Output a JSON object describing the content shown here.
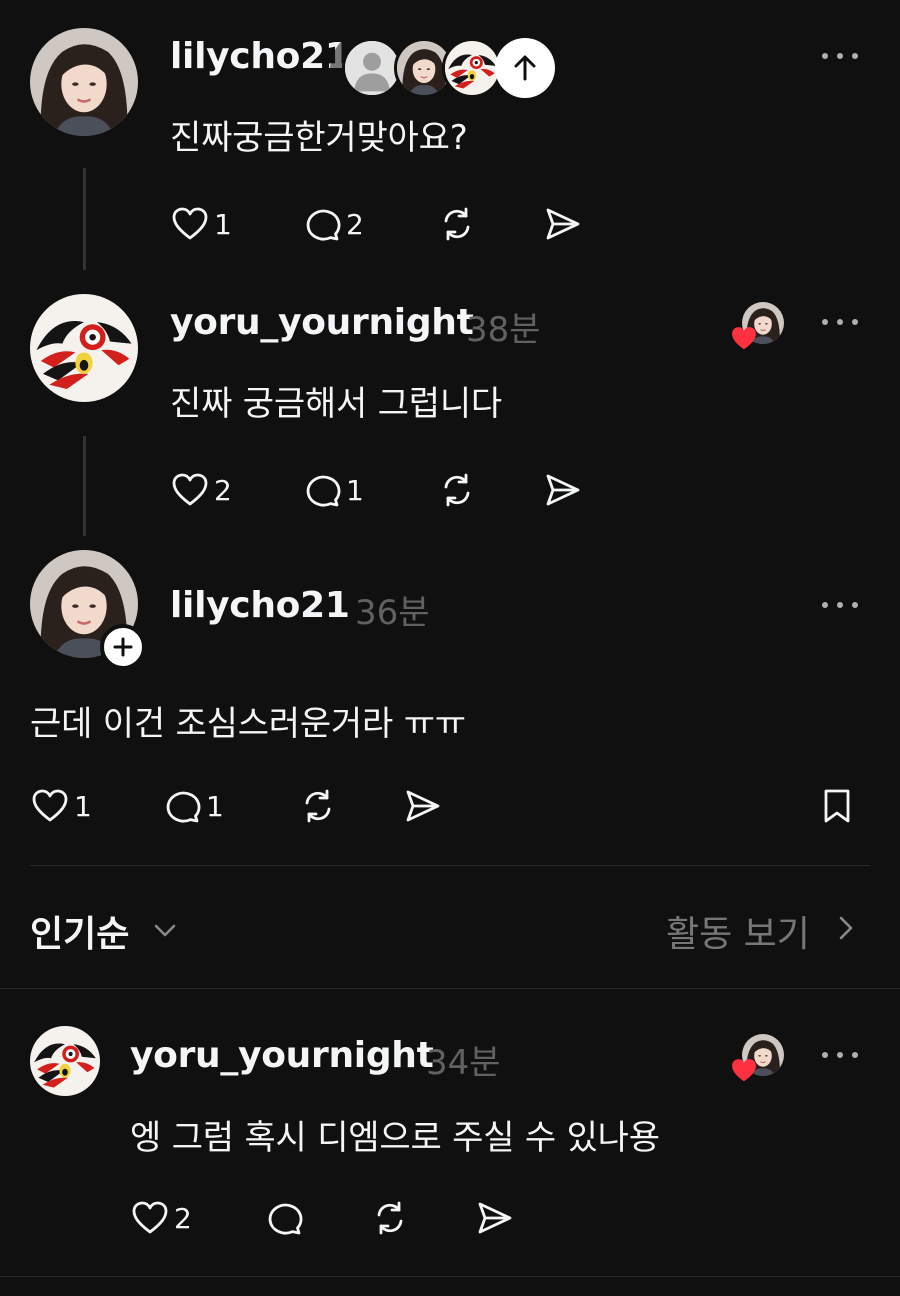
{
  "floating_bar": {
    "icons": [
      "default-avatar-icon",
      "woman-avatar-icon",
      "bird-avatar-icon",
      "arrow-up-icon"
    ]
  },
  "comments": [
    {
      "username": "lilycho21",
      "time": "",
      "text": "진짜궁금한거맞아요?",
      "likes": "1",
      "replies": "2"
    },
    {
      "username": "yoru_yournight",
      "time": "38분",
      "text": "진짜 궁금해서 그럽니다",
      "likes": "2",
      "replies": "1"
    },
    {
      "username": "lilycho21",
      "time": "36분",
      "text": "근데 이건  조심스러운거라 ㅠㅠ",
      "likes": "1",
      "replies": "1"
    }
  ],
  "sort": {
    "label": "인기순",
    "activity_link": "활동 보기"
  },
  "reply": {
    "username": "yoru_yournight",
    "time": "34분",
    "text": "엥 그럼 혹시 디엠으로 주실 수 있나용",
    "likes": "2",
    "replies": ""
  },
  "colors": {
    "background": "#101010",
    "text": "#f3f5f7",
    "muted": "#616161",
    "heart": "#ff3040"
  }
}
